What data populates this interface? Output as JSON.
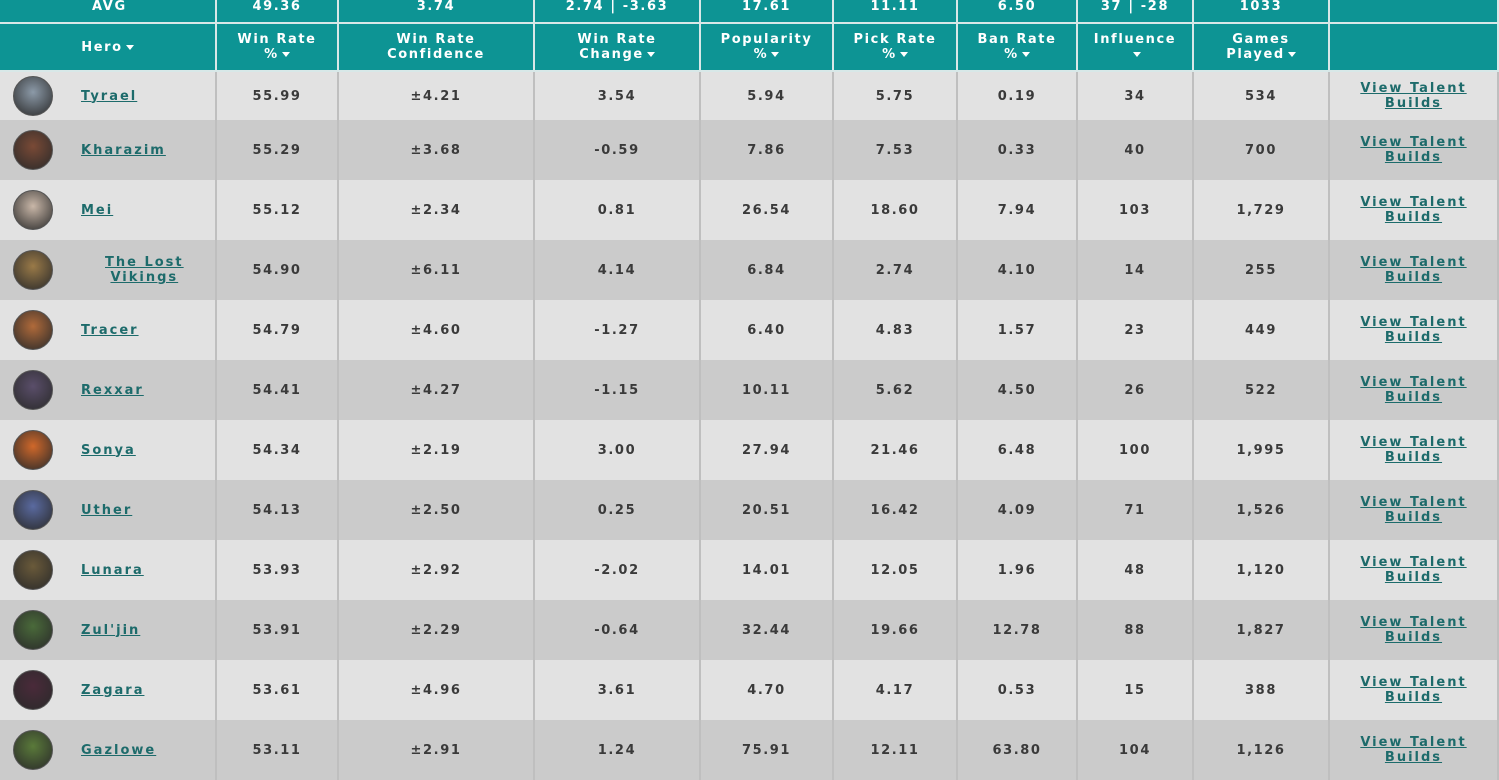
{
  "avg": {
    "label": "AVG",
    "win_rate": "49.36",
    "win_rate_confidence": "3.74",
    "win_rate_change": "2.74 | -3.63",
    "popularity": "17.61",
    "pick_rate": "11.11",
    "ban_rate": "6.50",
    "influence": "37 | -28",
    "games_played": "1033"
  },
  "headers": {
    "hero": "Hero",
    "win_rate_l1": "Win Rate",
    "win_rate_l2": "%",
    "confidence_l1": "Win Rate",
    "confidence_l2": "Confidence",
    "change_l1": "Win Rate",
    "change_l2": "Change",
    "popularity_l1": "Popularity",
    "popularity_l2": "%",
    "pick_l1": "Pick Rate",
    "pick_l2": "%",
    "ban_l1": "Ban Rate",
    "ban_l2": "%",
    "influence_l1": "Influence",
    "influence_l2": "",
    "games_l1": "Games",
    "games_l2": "Played"
  },
  "talent_label_l1": "View Talent",
  "talent_label_l2": "Builds",
  "rows": [
    {
      "hero_l1": "Tyrael",
      "hero_l2": "",
      "win_rate": "55.99",
      "confidence": "±4.21",
      "change": "3.54",
      "popularity": "5.94",
      "pick_rate": "5.75",
      "ban_rate": "0.19",
      "influence": "34",
      "games": "534",
      "avatar_color": "#8c9aa8"
    },
    {
      "hero_l1": "Kharazim",
      "hero_l2": "",
      "win_rate": "55.29",
      "confidence": "±3.68",
      "change": "-0.59",
      "popularity": "7.86",
      "pick_rate": "7.53",
      "ban_rate": "0.33",
      "influence": "40",
      "games": "700",
      "avatar_color": "#7a4a36"
    },
    {
      "hero_l1": "Mei",
      "hero_l2": "",
      "win_rate": "55.12",
      "confidence": "±2.34",
      "change": "0.81",
      "popularity": "26.54",
      "pick_rate": "18.60",
      "ban_rate": "7.94",
      "influence": "103",
      "games": "1,729",
      "avatar_color": "#c9b7a8"
    },
    {
      "hero_l1": "The Lost",
      "hero_l2": "Vikings",
      "win_rate": "54.90",
      "confidence": "±6.11",
      "change": "4.14",
      "popularity": "6.84",
      "pick_rate": "2.74",
      "ban_rate": "4.10",
      "influence": "14",
      "games": "255",
      "avatar_color": "#9a7a48"
    },
    {
      "hero_l1": "Tracer",
      "hero_l2": "",
      "win_rate": "54.79",
      "confidence": "±4.60",
      "change": "-1.27",
      "popularity": "6.40",
      "pick_rate": "4.83",
      "ban_rate": "1.57",
      "influence": "23",
      "games": "449",
      "avatar_color": "#b06a3a"
    },
    {
      "hero_l1": "Rexxar",
      "hero_l2": "",
      "win_rate": "54.41",
      "confidence": "±4.27",
      "change": "-1.15",
      "popularity": "10.11",
      "pick_rate": "5.62",
      "ban_rate": "4.50",
      "influence": "26",
      "games": "522",
      "avatar_color": "#5a4e6a"
    },
    {
      "hero_l1": "Sonya",
      "hero_l2": "",
      "win_rate": "54.34",
      "confidence": "±2.19",
      "change": "3.00",
      "popularity": "27.94",
      "pick_rate": "21.46",
      "ban_rate": "6.48",
      "influence": "100",
      "games": "1,995",
      "avatar_color": "#d0682a"
    },
    {
      "hero_l1": "Uther",
      "hero_l2": "",
      "win_rate": "54.13",
      "confidence": "±2.50",
      "change": "0.25",
      "popularity": "20.51",
      "pick_rate": "16.42",
      "ban_rate": "4.09",
      "influence": "71",
      "games": "1,526",
      "avatar_color": "#5a6aa0"
    },
    {
      "hero_l1": "Lunara",
      "hero_l2": "",
      "win_rate": "53.93",
      "confidence": "±2.92",
      "change": "-2.02",
      "popularity": "14.01",
      "pick_rate": "12.05",
      "ban_rate": "1.96",
      "influence": "48",
      "games": "1,120",
      "avatar_color": "#6a5a3a"
    },
    {
      "hero_l1": "Zul'jin",
      "hero_l2": "",
      "win_rate": "53.91",
      "confidence": "±2.29",
      "change": "-0.64",
      "popularity": "32.44",
      "pick_rate": "19.66",
      "ban_rate": "12.78",
      "influence": "88",
      "games": "1,827",
      "avatar_color": "#4a6a3a"
    },
    {
      "hero_l1": "Zagara",
      "hero_l2": "",
      "win_rate": "53.61",
      "confidence": "±4.96",
      "change": "3.61",
      "popularity": "4.70",
      "pick_rate": "4.17",
      "ban_rate": "0.53",
      "influence": "15",
      "games": "388",
      "avatar_color": "#4a2a3a"
    },
    {
      "hero_l1": "Gazlowe",
      "hero_l2": "",
      "win_rate": "53.11",
      "confidence": "±2.91",
      "change": "1.24",
      "popularity": "75.91",
      "pick_rate": "12.11",
      "ban_rate": "63.80",
      "influence": "104",
      "games": "1,126",
      "avatar_color": "#5a7a3a"
    }
  ]
}
